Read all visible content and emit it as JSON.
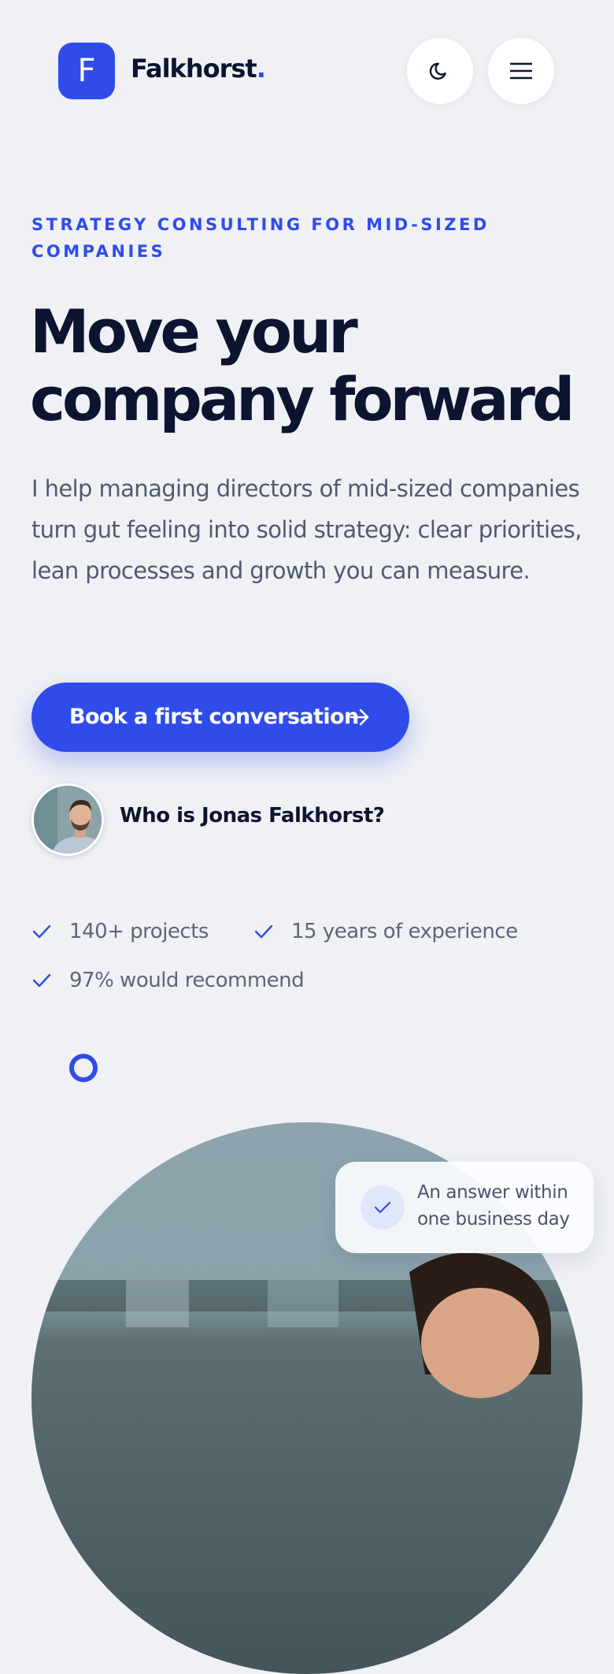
{
  "header": {
    "logo_letter": "F",
    "brand_name": "Falkhorst",
    "brand_dot": ".",
    "theme_toggle_icon": "moon-icon",
    "menu_icon": "hamburger-menu-icon"
  },
  "hero": {
    "eyebrow": "STRATEGY CONSULTING FOR MID-SIZED COMPANIES",
    "headline_line1": "Move your",
    "headline_line2": "company forward",
    "lead": "I help managing directors of mid-sized companies turn gut feeling into solid strategy: clear priorities, lean processes and growth you can measure.",
    "cta_label": "Book a first conversation",
    "cta_icon": "arrow-right-icon",
    "person_label": "Who is Jonas Falkhorst?"
  },
  "highlights": [
    {
      "label": "140+ projects",
      "icon": "check-icon"
    },
    {
      "label": "15 years of experience",
      "icon": "check-icon"
    },
    {
      "label": "97% would recommend",
      "icon": "check-icon"
    }
  ],
  "badge": {
    "icon": "check-icon",
    "line1": "An answer within",
    "line2": "one business day"
  },
  "colors": {
    "accent": "#2f4cea",
    "background": "#eff1f5",
    "heading": "#0d1430",
    "body_text": "#515a70"
  }
}
